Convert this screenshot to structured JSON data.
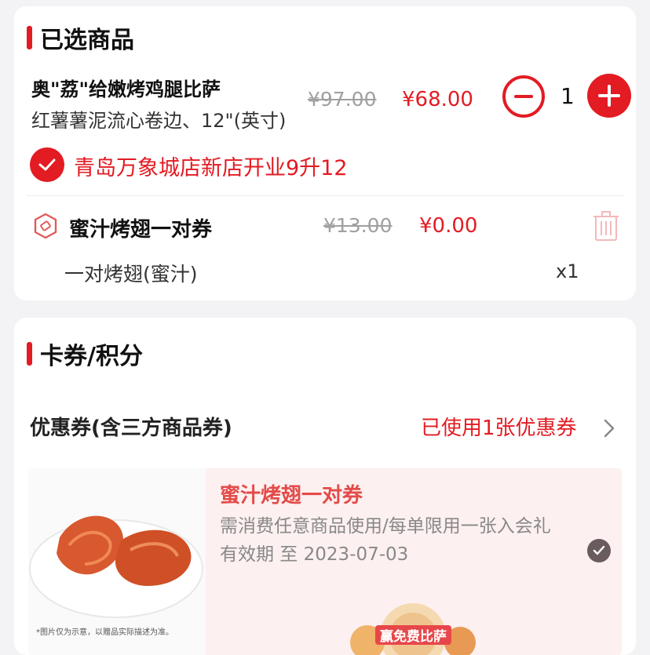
{
  "selected_items": {
    "title": "已选商品",
    "product": {
      "name": "奥\"荔\"给嫩烤鸡腿比萨",
      "desc": "红薯薯泥流心卷边、12\"(英寸)",
      "price_original": "¥97.00",
      "price_current": "¥68.00",
      "quantity": "1"
    },
    "promotion": "青岛万象城店新店开业9升12",
    "coupon_item": {
      "name": "蜜汁烤翅一对券",
      "price_original": "¥13.00",
      "price_current": "¥0.00",
      "item": "一对烤翅(蜜汁)",
      "qty": "x1"
    }
  },
  "cards_points": {
    "title": "卡券/积分",
    "coupon_row": {
      "label": "优惠券(含三方商品券)",
      "value": "已使用1张优惠券"
    },
    "coupon_card": {
      "title": "蜜汁烤翅一对券",
      "subtitle": "需消费任意商品使用/每单限用一张入会礼",
      "validity": "有效期 至 2023-07-03",
      "image_caption": "*图片仅为示意，以赠品实际描述为准。",
      "promo_badge": "赢免费比萨"
    }
  },
  "colors": {
    "accent": "#e31b23",
    "coupon_bg": "#fdf0f0"
  }
}
